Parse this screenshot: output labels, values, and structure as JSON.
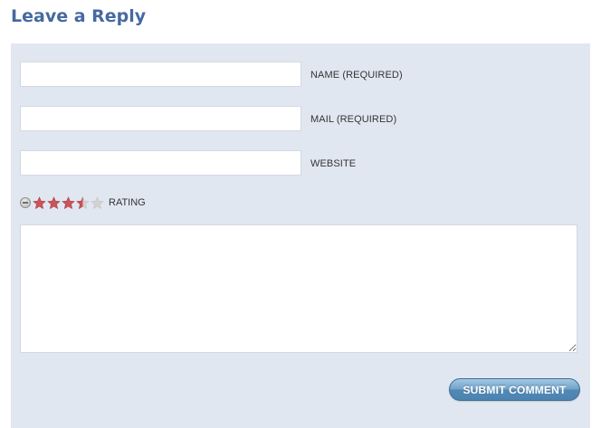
{
  "heading": "Leave a Reply",
  "form": {
    "name_field": {
      "value": "",
      "label": "NAME (REQUIRED)"
    },
    "mail_field": {
      "value": "",
      "label": "MAIL (REQUIRED)"
    },
    "website_field": {
      "value": "",
      "label": "WEBSITE"
    },
    "rating": {
      "label": "RATING",
      "value": 3.5,
      "max": 5,
      "cancel_icon": "minus-circle-icon",
      "star_icon": "star-icon"
    },
    "comment": {
      "value": ""
    },
    "submit_label": "SUBMIT COMMENT"
  },
  "colors": {
    "heading": "#46699f",
    "panel_background": "#e1e7f1",
    "star_filled": "#c9545a",
    "star_empty": "#d2d2d2",
    "button": "#5a8fbc"
  }
}
